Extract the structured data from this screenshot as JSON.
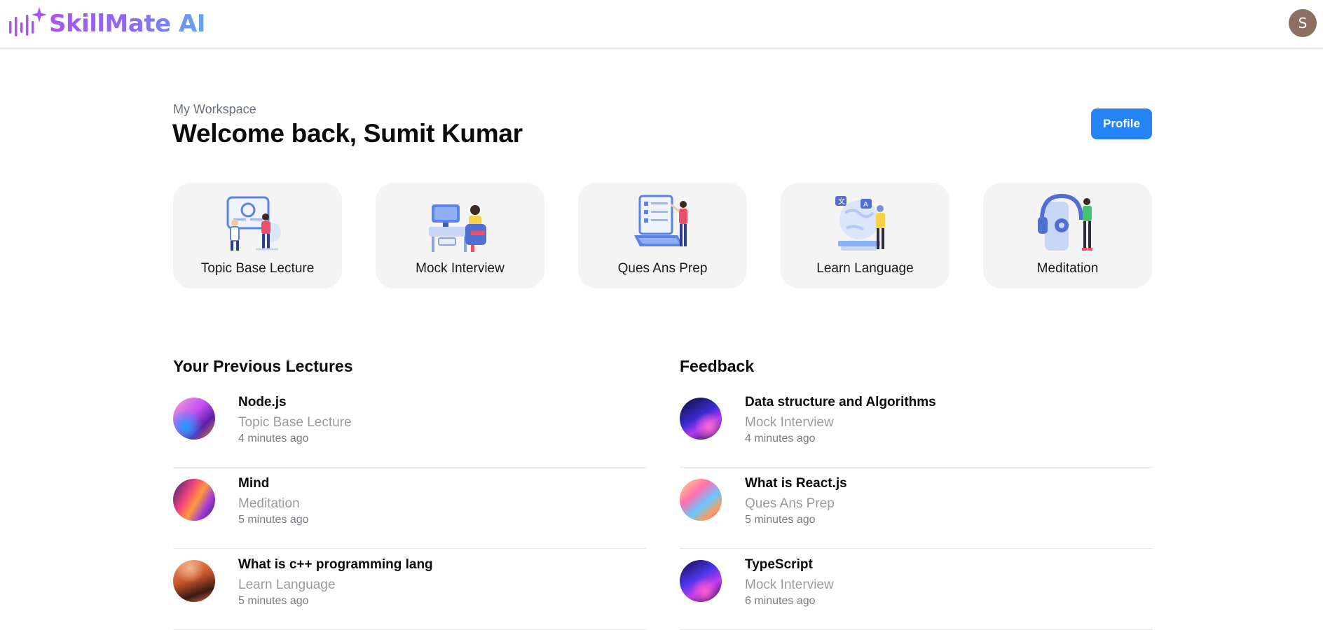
{
  "header": {
    "brand": "SkillMate AI",
    "logo_icon": "sparkle-waveform-icon",
    "avatar_initial": "S",
    "colors": {
      "brand_start": "#a855f7",
      "brand_end": "#60a5fa",
      "avatar_bg": "#8d6e63"
    }
  },
  "workspace": {
    "kicker": "My Workspace",
    "title": "Welcome back, Sumit Kumar",
    "profile_button": "Profile",
    "accent": "#2483f5"
  },
  "features": [
    {
      "label": "Topic Base Lecture",
      "icon": "lecture-whiteboard-icon"
    },
    {
      "label": "Mock Interview",
      "icon": "interview-desk-icon"
    },
    {
      "label": "Ques Ans Prep",
      "icon": "laptop-checklist-icon"
    },
    {
      "label": "Learn Language",
      "icon": "globe-language-icon"
    },
    {
      "label": "Meditation",
      "icon": "headphones-meditation-icon"
    }
  ],
  "previous_lectures": {
    "title": "Your Previous Lectures",
    "items": [
      {
        "title": "Node.js",
        "type": "Topic Base Lecture",
        "time": "4 minutes ago"
      },
      {
        "title": "Mind",
        "type": "Meditation",
        "time": "5 minutes ago"
      },
      {
        "title": "What is c++ programming lang",
        "type": "Learn Language",
        "time": "5 minutes ago"
      }
    ]
  },
  "feedback": {
    "title": "Feedback",
    "items": [
      {
        "title": "Data structure and Algorithms",
        "type": "Mock Interview",
        "time": "4 minutes ago"
      },
      {
        "title": "What is React.js",
        "type": "Ques Ans Prep",
        "time": "5 minutes ago"
      },
      {
        "title": "TypeScript",
        "type": "Mock Interview",
        "time": "6 minutes ago"
      }
    ]
  }
}
